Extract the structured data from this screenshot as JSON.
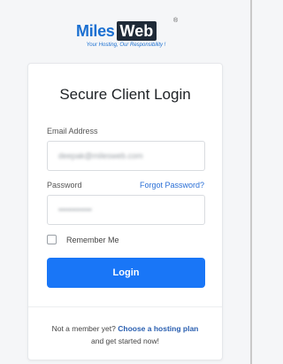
{
  "brand": {
    "name_part1": "Miles",
    "name_part2": "Web",
    "registered": "®",
    "tagline": "Your Hosting, Our Responsibility !"
  },
  "login": {
    "title": "Secure Client Login",
    "email_label": "Email Address",
    "email_value": "deepak@milesweb.com",
    "password_label": "Password",
    "forgot_label": "Forgot Password?",
    "password_value": "••••••••••••",
    "remember_label": "Remember Me",
    "submit_label": "Login"
  },
  "footer": {
    "prefix": "Not a member yet? ",
    "link": "Choose a hosting plan",
    "suffix": "and get started now!"
  }
}
